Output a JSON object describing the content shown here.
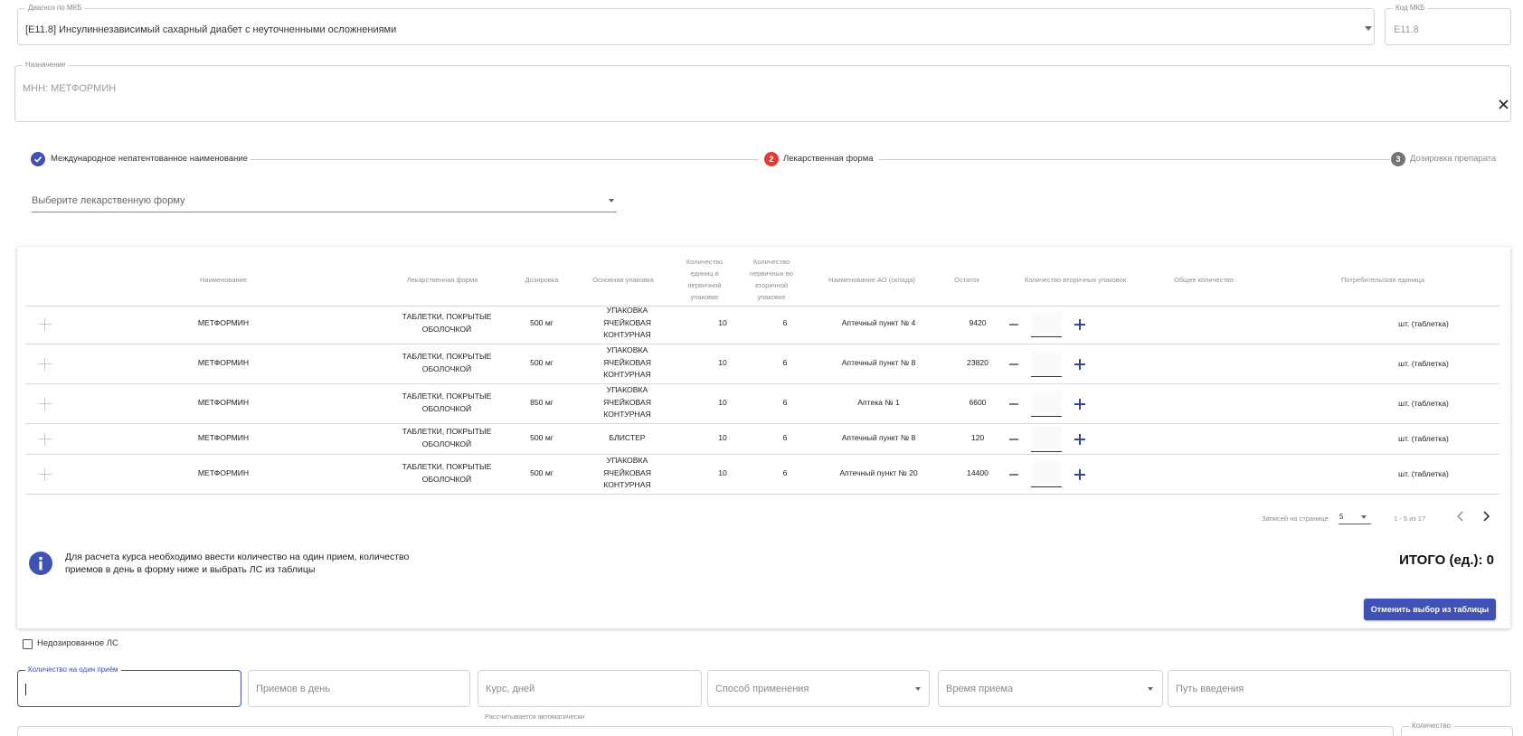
{
  "diagnosis": {
    "label": "Диагноз по МКБ",
    "value": "[E11.8] Инсулиннезависимый сахарный диабет с неуточненными осложнениями",
    "code_label": "Код МКБ",
    "code_value": "E11.8"
  },
  "prescription": {
    "label": "Назначение",
    "value": "МНН: МЕТФОРМИН"
  },
  "stepper": {
    "steps": [
      {
        "number": "1",
        "label": "Международное непатентованное наименование",
        "state": "done"
      },
      {
        "number": "2",
        "label": "Лекарственная форма",
        "state": "active"
      },
      {
        "number": "3",
        "label": "Дозировка препарата",
        "state": "pending"
      }
    ]
  },
  "form_select": {
    "placeholder": "Выберите лекарственную форму"
  },
  "table": {
    "headers": {
      "name": "Наименование",
      "form": "Лекарственная форма",
      "dosage": "Дозировка",
      "package": "Основная упаковка",
      "units": "Количество единиц в первичной упаковке",
      "primary": "Количество первичных во вторичной упаковке",
      "store": "Наименование АО (склада)",
      "stock": "Остаток",
      "secondary": "Количество вторичных упаковок",
      "total": "Общее количество",
      "consumer": "Потребительская единица"
    },
    "rows": [
      {
        "name": "МЕТФОРМИН",
        "form": "ТАБЛЕТКИ, ПОКРЫТЫЕ ОБОЛОЧКОЙ",
        "dosage": "500 мг",
        "package": "УПАКОВКА ЯЧЕЙКОВАЯ КОНТУРНАЯ",
        "units": "10",
        "primary": "6",
        "store": "Аптечный пункт № 4",
        "stock": "9420",
        "qty": "",
        "total": "",
        "consumer": "шт. (таблетка)"
      },
      {
        "name": "МЕТФОРМИН",
        "form": "ТАБЛЕТКИ, ПОКРЫТЫЕ ОБОЛОЧКОЙ",
        "dosage": "500 мг",
        "package": "УПАКОВКА ЯЧЕЙКОВАЯ КОНТУРНАЯ",
        "units": "10",
        "primary": "6",
        "store": "Аптечный пункт № 8",
        "stock": "23820",
        "qty": "",
        "total": "",
        "consumer": "шт. (таблетка)"
      },
      {
        "name": "МЕТФОРМИН",
        "form": "ТАБЛЕТКИ, ПОКРЫТЫЕ ОБОЛОЧКОЙ",
        "dosage": "850 мг",
        "package": "УПАКОВКА ЯЧЕЙКОВАЯ КОНТУРНАЯ",
        "units": "10",
        "primary": "6",
        "store": "Аптека № 1",
        "stock": "6600",
        "qty": "",
        "total": "",
        "consumer": "шт. (таблетка)"
      },
      {
        "name": "МЕТФОРМИН",
        "form": "ТАБЛЕТКИ, ПОКРЫТЫЕ ОБОЛОЧКОЙ",
        "dosage": "500 мг",
        "package": "БЛИСТЕР",
        "units": "10",
        "primary": "6",
        "store": "Аптечный пункт № 8",
        "stock": "120",
        "qty": "",
        "total": "",
        "consumer": "шт. (таблетка)"
      },
      {
        "name": "МЕТФОРМИН",
        "form": "ТАБЛЕТКИ, ПОКРЫТЫЕ ОБОЛОЧКОЙ",
        "dosage": "500 мг",
        "package": "УПАКОВКА ЯЧЕЙКОВАЯ КОНТУРНАЯ",
        "units": "10",
        "primary": "6",
        "store": "Аптечный пункт № 20",
        "stock": "14400",
        "qty": "",
        "total": "",
        "consumer": "шт. (таблетка)"
      }
    ]
  },
  "pagination": {
    "rows_label": "Записей на странице",
    "rows_value": "5",
    "range": "1 - 5 из 17"
  },
  "info": {
    "text": "Для расчета курса необходимо ввести количество на один прием, количество приемов в день в форму ниже и выбрать ЛС из таблицы"
  },
  "total": {
    "label": "ИТОГО (ед.): 0"
  },
  "cancel_button": "Отменить выбор из таблицы",
  "undosed": {
    "label": "Недозированное ЛС"
  },
  "dose_form": {
    "qty_label": "Количество на один приём",
    "per_day": "Приемов в день",
    "course": "Курс, дней",
    "course_helper": "Рассчитывается автоматически",
    "method": "Способ применения",
    "time": "Время приема",
    "route": "Путь введения",
    "quantity_label": "Количество"
  },
  "colors": {
    "primary": "#3f51b5",
    "step_active": "#e53935",
    "step_pending": "#757575"
  }
}
